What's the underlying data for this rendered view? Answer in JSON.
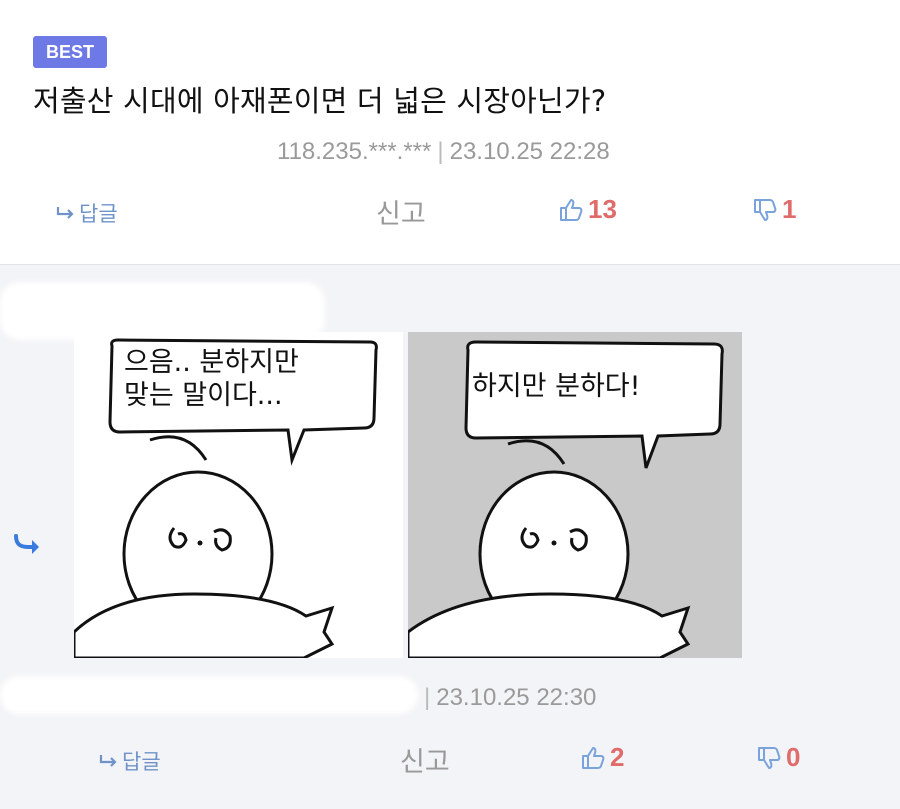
{
  "comment1": {
    "badge": "BEST",
    "title": "저출산 시대에 아재폰이면 더 넓은 시장아닌가?",
    "ip": "118.235.***.***",
    "separator": "|",
    "date": "23.10.25 22:28",
    "reply_label": "답글",
    "report_label": "신고",
    "likes": "13",
    "dislikes": "1"
  },
  "comment2": {
    "separator": "|",
    "date": "23.10.25 22:30",
    "reply_label": "답글",
    "report_label": "신고",
    "likes": "2",
    "dislikes": "0",
    "image": {
      "panel1_line1": "으음.. 분하지만",
      "panel1_line2": "맞는 말이다...",
      "panel2_text": "하지만 분하다!"
    }
  },
  "colors": {
    "badge": "#6d7ae6",
    "reply": "#6f93c9",
    "count": "#e06b6b",
    "thumb": "#7aa2db",
    "reply_arrow": "#3a7be0",
    "comment_bg": "#f3f4f7"
  },
  "icons": [
    "reply-arrow-icon",
    "thumbs-up-icon",
    "thumbs-down-icon",
    "nested-reply-icon"
  ]
}
